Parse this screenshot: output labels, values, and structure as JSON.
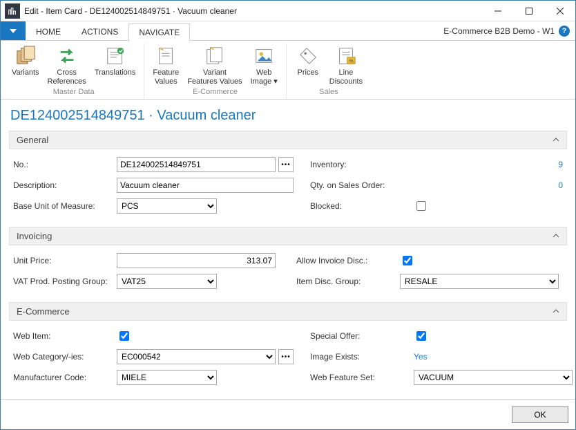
{
  "window": {
    "title": "Edit - Item Card - DE124002514849751 · Vacuum cleaner",
    "company": "E-Commerce B2B Demo - W1"
  },
  "tabs": {
    "home": "HOME",
    "actions": "ACTIONS",
    "navigate": "NAVIGATE"
  },
  "ribbon": {
    "variants": "Variants",
    "cross_references": "Cross\nReferences",
    "translations": "Translations",
    "feature_values": "Feature\nValues",
    "variant_features_values": "Variant\nFeatures Values",
    "web_image": "Web\nImage",
    "prices": "Prices",
    "line_discounts": "Line\nDiscounts",
    "group_master_data": "Master Data",
    "group_ecommerce": "E-Commerce",
    "group_sales": "Sales"
  },
  "record_title": "DE124002514849751 · Vacuum cleaner",
  "sections": {
    "general": "General",
    "invoicing": "Invoicing",
    "ecommerce": "E-Commerce"
  },
  "labels": {
    "no": "No.:",
    "description": "Description:",
    "base_uom": "Base Unit of Measure:",
    "inventory": "Inventory:",
    "qty_sales_order": "Qty. on Sales Order:",
    "blocked": "Blocked:",
    "unit_price": "Unit Price:",
    "vat_group": "VAT Prod. Posting Group:",
    "allow_inv_disc": "Allow Invoice Disc.:",
    "item_disc_group": "Item Disc. Group:",
    "web_item": "Web Item:",
    "web_category": "Web Category/-ies:",
    "manufacturer": "Manufacturer Code:",
    "special_offer": "Special Offer:",
    "image_exists": "Image Exists:",
    "web_feature_set": "Web Feature Set:"
  },
  "values": {
    "no": "DE124002514849751",
    "description": "Vacuum cleaner",
    "base_uom": "PCS",
    "inventory": "9",
    "qty_sales_order": "0",
    "blocked": false,
    "unit_price": "313.07",
    "vat_group": "VAT25",
    "allow_inv_disc": true,
    "item_disc_group": "RESALE",
    "web_item": true,
    "web_category": "EC000542",
    "manufacturer": "MIELE",
    "special_offer": true,
    "image_exists": "Yes",
    "web_feature_set": "VACUUM"
  },
  "footer": {
    "ok": "OK"
  }
}
